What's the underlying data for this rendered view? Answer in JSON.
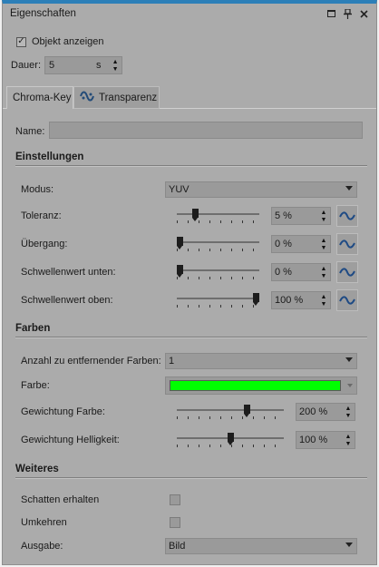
{
  "panel": {
    "title": "Eigenschaften",
    "titlebar_icons": [
      "window-icon",
      "pin-icon",
      "close-icon"
    ]
  },
  "object": {
    "show_label": "Objekt anzeigen",
    "show_checked": true,
    "duration_label": "Dauer:",
    "duration_value": "5",
    "duration_unit": "s"
  },
  "tabs": [
    {
      "label": "Chroma-Key",
      "active": true
    },
    {
      "label": "Transparenz",
      "active": false,
      "icon": "transparency-icon"
    }
  ],
  "name": {
    "label": "Name:",
    "value": ""
  },
  "sections": {
    "settings": "Einstellungen",
    "colors": "Farben",
    "more": "Weiteres"
  },
  "settings": {
    "mode": {
      "label": "Modus:",
      "value": "YUV"
    },
    "tolerance": {
      "label": "Toleranz:",
      "value": "5 %",
      "level": 0.2
    },
    "transition": {
      "label": "Übergang:",
      "value": "0 %",
      "level": 0.0
    },
    "threshold_low": {
      "label": "Schwellenwert unten:",
      "value": "0 %",
      "level": 0.0
    },
    "threshold_high": {
      "label": "Schwellenwert oben:",
      "value": "100 %",
      "level": 1.0
    }
  },
  "colors": {
    "count": {
      "label": "Anzahl zu entfernender Farben:",
      "value": "1"
    },
    "color": {
      "label": "Farbe:",
      "swatch": "#00ff00"
    },
    "weight_color": {
      "label": "Gewichtung Farbe:",
      "value": "200 %",
      "level": 0.67
    },
    "weight_brightness": {
      "label": "Gewichtung Helligkeit:",
      "value": "100 %",
      "level": 0.5
    }
  },
  "more": {
    "keep_shadow": {
      "label": "Schatten erhalten",
      "checked": false
    },
    "invert": {
      "label": "Umkehren",
      "checked": false
    },
    "output": {
      "label": "Ausgabe:",
      "value": "Bild"
    }
  },
  "accent": "#2c7fb8"
}
